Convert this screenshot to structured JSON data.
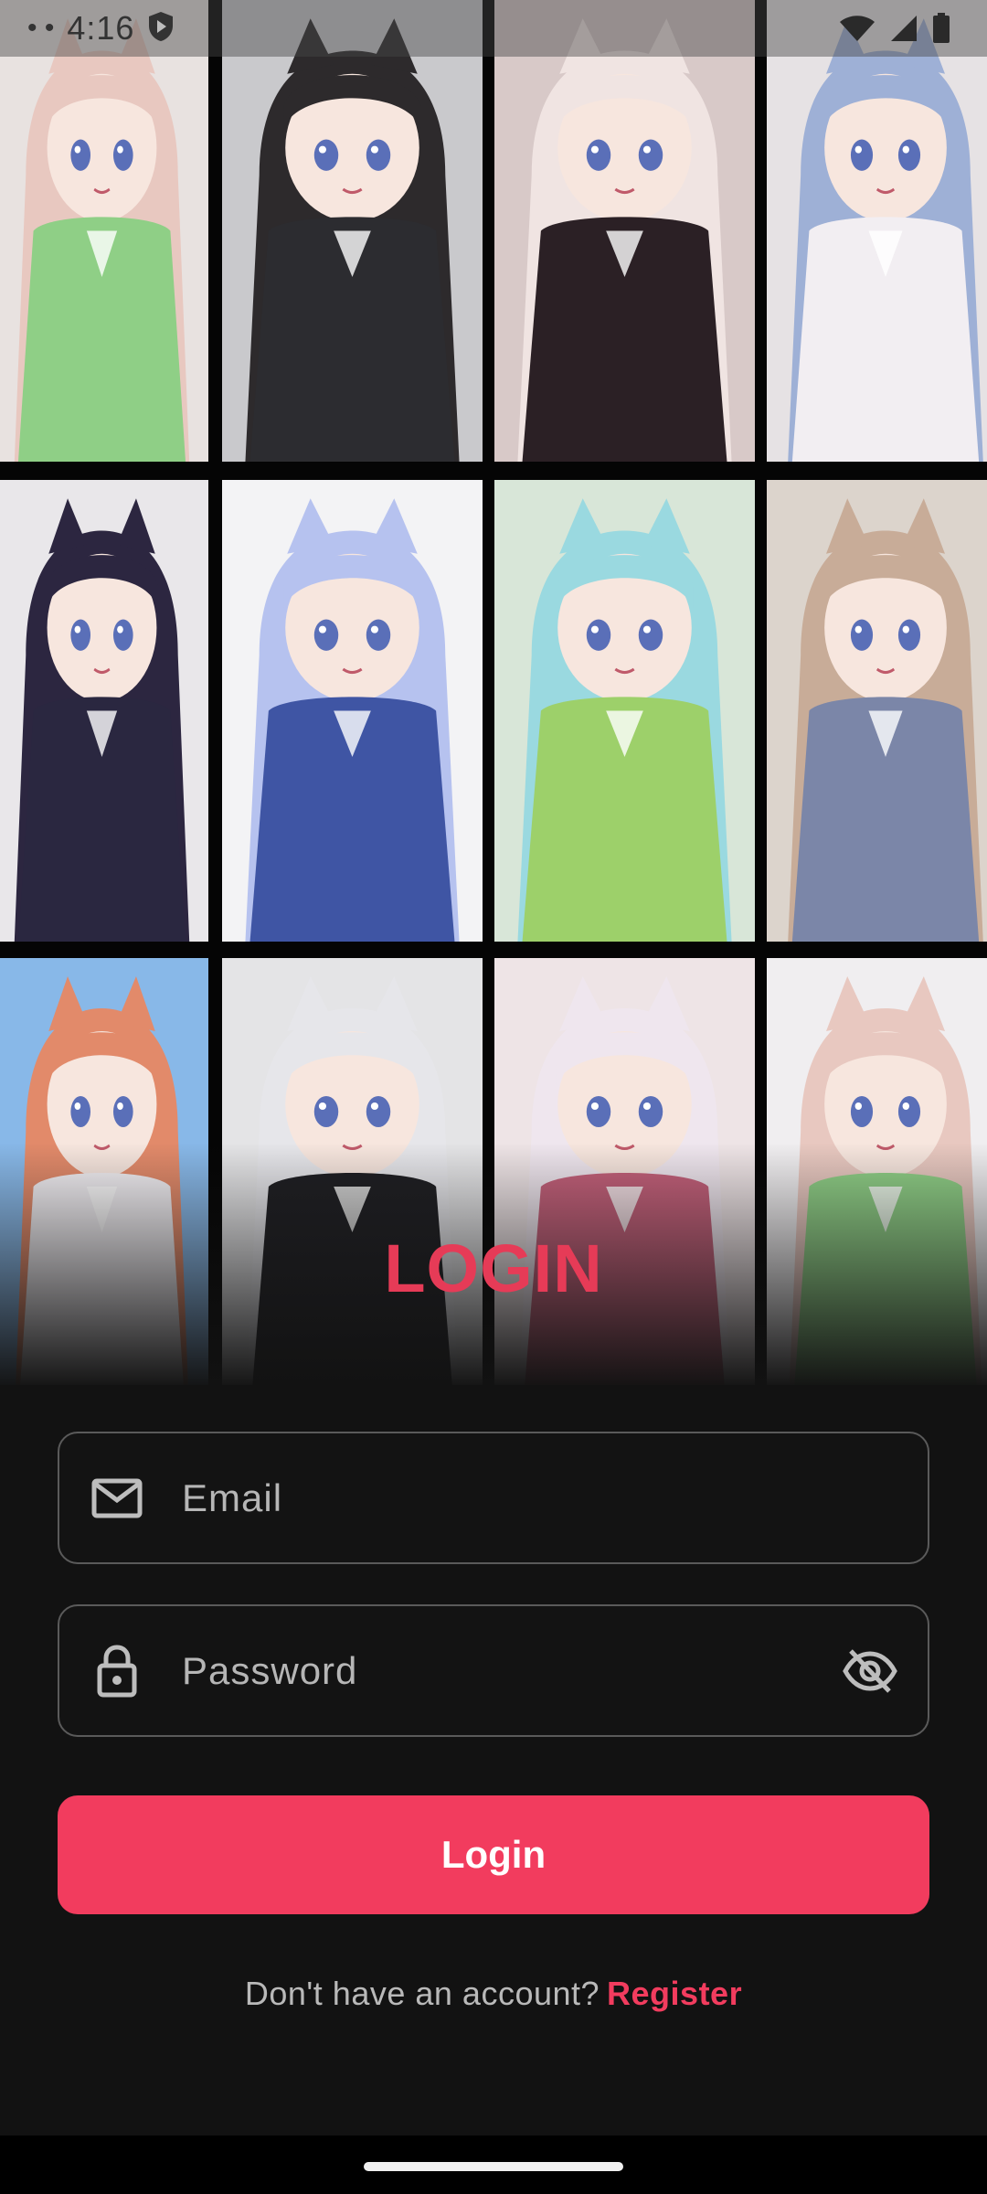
{
  "status_bar": {
    "time": "4:16",
    "dots": "• •",
    "icons": [
      "shield-icon",
      "wifi-icon",
      "signal-icon",
      "battery-icon"
    ]
  },
  "wallpaper_grid": {
    "rows": 3,
    "columns": 4,
    "tiles": [
      {
        "row": 0,
        "col": 0,
        "bg": "#e8e2e0",
        "accent": "#8fcf86",
        "hair": "#e8c8c0"
      },
      {
        "row": 0,
        "col": 1,
        "bg": "#c9c9cc",
        "accent": "#2c2c30",
        "hair": "#2d2a2c"
      },
      {
        "row": 0,
        "col": 2,
        "bg": "#d8c9c8",
        "accent": "#2b2025",
        "hair": "#f0e4e2"
      },
      {
        "row": 0,
        "col": 3,
        "bg": "#e6e2e4",
        "accent": "#f2eef2",
        "hair": "#9eb0d6"
      },
      {
        "row": 1,
        "col": 0,
        "bg": "#e9e7ea",
        "accent": "#2a2740",
        "hair": "#2c2640"
      },
      {
        "row": 1,
        "col": 1,
        "bg": "#f3f3f5",
        "accent": "#3f55a4",
        "hair": "#b6c2ef"
      },
      {
        "row": 1,
        "col": 2,
        "bg": "#d8e6d8",
        "accent": "#9dd06a",
        "hair": "#9ad9e0"
      },
      {
        "row": 1,
        "col": 3,
        "bg": "#dcd4cc",
        "accent": "#7b86a8",
        "hair": "#c8ac98"
      },
      {
        "row": 2,
        "col": 0,
        "bg": "#88b8e8",
        "accent": "#f3f0f4",
        "hair": "#e28a6a"
      },
      {
        "row": 2,
        "col": 1,
        "bg": "#e4e4e6",
        "accent": "#1e1e22",
        "hair": "#e6e6ea"
      },
      {
        "row": 2,
        "col": 2,
        "bg": "#eee4e6",
        "accent": "#c4607a",
        "hair": "#efe6ee"
      },
      {
        "row": 2,
        "col": 3,
        "bg": "#f0eef0",
        "accent": "#8fcf86",
        "hair": "#e8c8c0"
      }
    ]
  },
  "login": {
    "title": "LOGIN",
    "email_placeholder": "Email",
    "password_placeholder": "Password",
    "button_label": "Login",
    "register_prompt": "Don't have an account?",
    "register_link": "Register"
  },
  "colors": {
    "accent": "#f23c5e",
    "title": "#e63b57",
    "background": "#121212",
    "field_border": "#5a5a5a"
  }
}
